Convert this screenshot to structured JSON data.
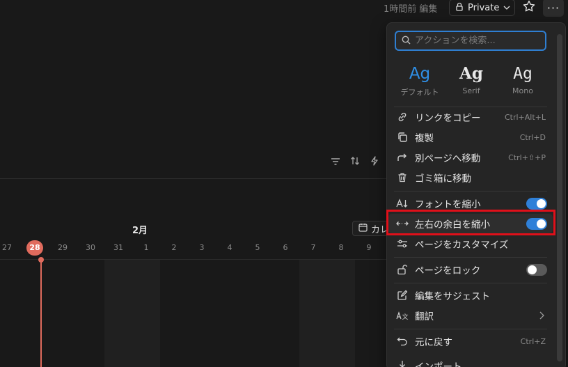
{
  "topbar": {
    "edited": "1時間前 編集",
    "private_label": "Private"
  },
  "timeline": {
    "month": "2月",
    "calendar_label": "カレ",
    "today": "28",
    "days": [
      "27",
      "28",
      "29",
      "30",
      "31",
      "1",
      "2",
      "3",
      "4",
      "5",
      "6",
      "7",
      "8",
      "9"
    ]
  },
  "menu": {
    "search_placeholder": "アクションを検索...",
    "fonts": [
      {
        "sample": "Ag",
        "label": "デフォルト"
      },
      {
        "sample": "Ag",
        "label": "Serif"
      },
      {
        "sample": "Ag",
        "label": "Mono"
      }
    ],
    "items": {
      "copy_link": {
        "label": "リンクをコピー",
        "shortcut": "Ctrl+Alt+L"
      },
      "duplicate": {
        "label": "複製",
        "shortcut": "Ctrl+D"
      },
      "move": {
        "label": "別ページへ移動",
        "shortcut": "Ctrl+⇧+P"
      },
      "trash": {
        "label": "ゴミ箱に移動"
      },
      "small_text": {
        "label": "フォントを縮小",
        "on": true
      },
      "full_width": {
        "label": "左右の余白を縮小",
        "on": true
      },
      "customize": {
        "label": "ページをカスタマイズ"
      },
      "lock": {
        "label": "ページをロック",
        "on": false
      },
      "suggest": {
        "label": "編集をサジェスト"
      },
      "translate": {
        "label": "翻訳"
      },
      "undo": {
        "label": "元に戻す",
        "shortcut": "Ctrl+Z"
      },
      "import": {
        "label": "インポート"
      }
    }
  },
  "colors": {
    "accent": "#2f80d8",
    "today": "#e06b5d",
    "highlight_box": "#e0101a"
  }
}
